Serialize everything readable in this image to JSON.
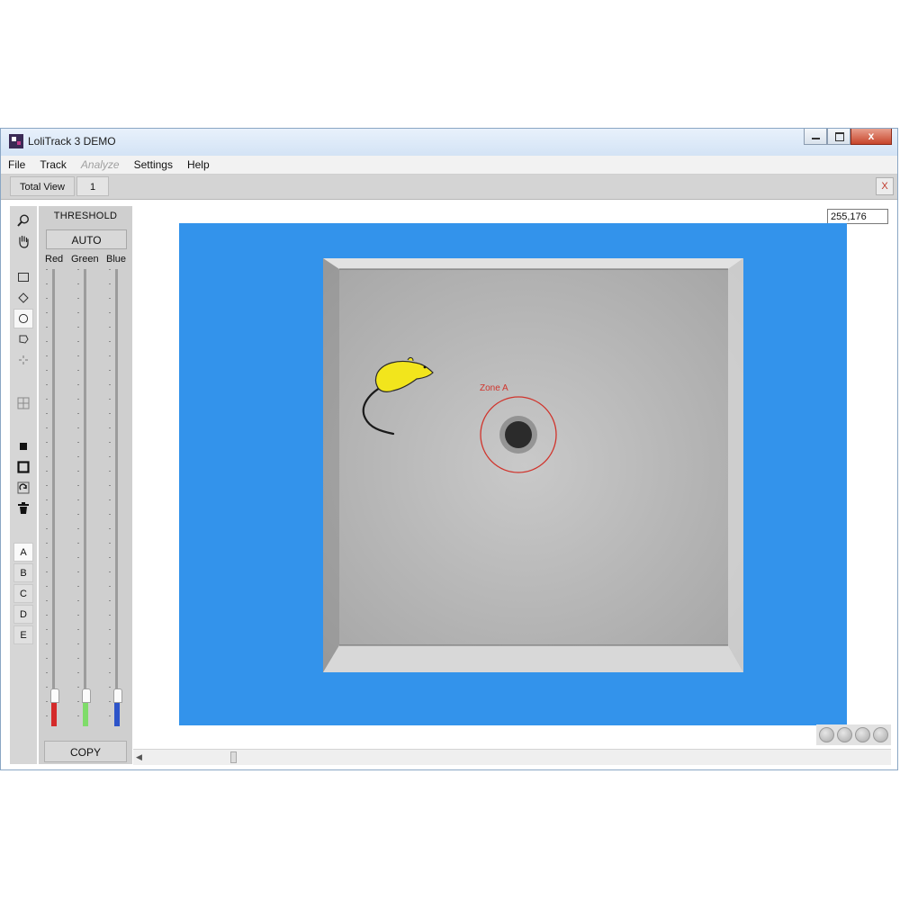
{
  "window": {
    "title": "LoliTrack 3 DEMO",
    "controls": {
      "close_glyph": "x"
    }
  },
  "menu": {
    "items": [
      {
        "label": "File",
        "enabled": true
      },
      {
        "label": "Track",
        "enabled": true
      },
      {
        "label": "Analyze",
        "enabled": false
      },
      {
        "label": "Settings",
        "enabled": true
      },
      {
        "label": "Help",
        "enabled": true
      }
    ]
  },
  "tabs": {
    "items": [
      {
        "label": "Total View"
      },
      {
        "label": "1"
      }
    ],
    "active_index": 1,
    "close_label": "X"
  },
  "tools": {
    "icons": [
      "zoom-icon",
      "pan-hand-icon",
      "rectangle-zone-icon",
      "diamond-zone-icon",
      "circle-zone-icon",
      "polygon-zone-icon",
      "point-icon",
      "grid-icon",
      "filled-square-icon",
      "outline-square-icon",
      "rotate-icon",
      "trash-icon"
    ],
    "selected": "circle-zone-icon",
    "zones": [
      "A",
      "B",
      "C",
      "D",
      "E"
    ],
    "selected_zone": "A"
  },
  "threshold": {
    "title": "THRESHOLD",
    "auto_label": "AUTO",
    "channels": [
      {
        "label": "Red",
        "color": "#d42a2a",
        "level": 0.06
      },
      {
        "label": "Green",
        "color": "#7fdc6a",
        "level": 0.06
      },
      {
        "label": "Blue",
        "color": "#2d54c9",
        "level": 0.06
      }
    ],
    "copy_label": "COPY"
  },
  "viewer": {
    "coordinate_readout": "255,176",
    "background_color": "#3393eb",
    "zone_label": "Zone A",
    "zone_color": "#d0342c",
    "animal_color": "#f2e51c"
  }
}
